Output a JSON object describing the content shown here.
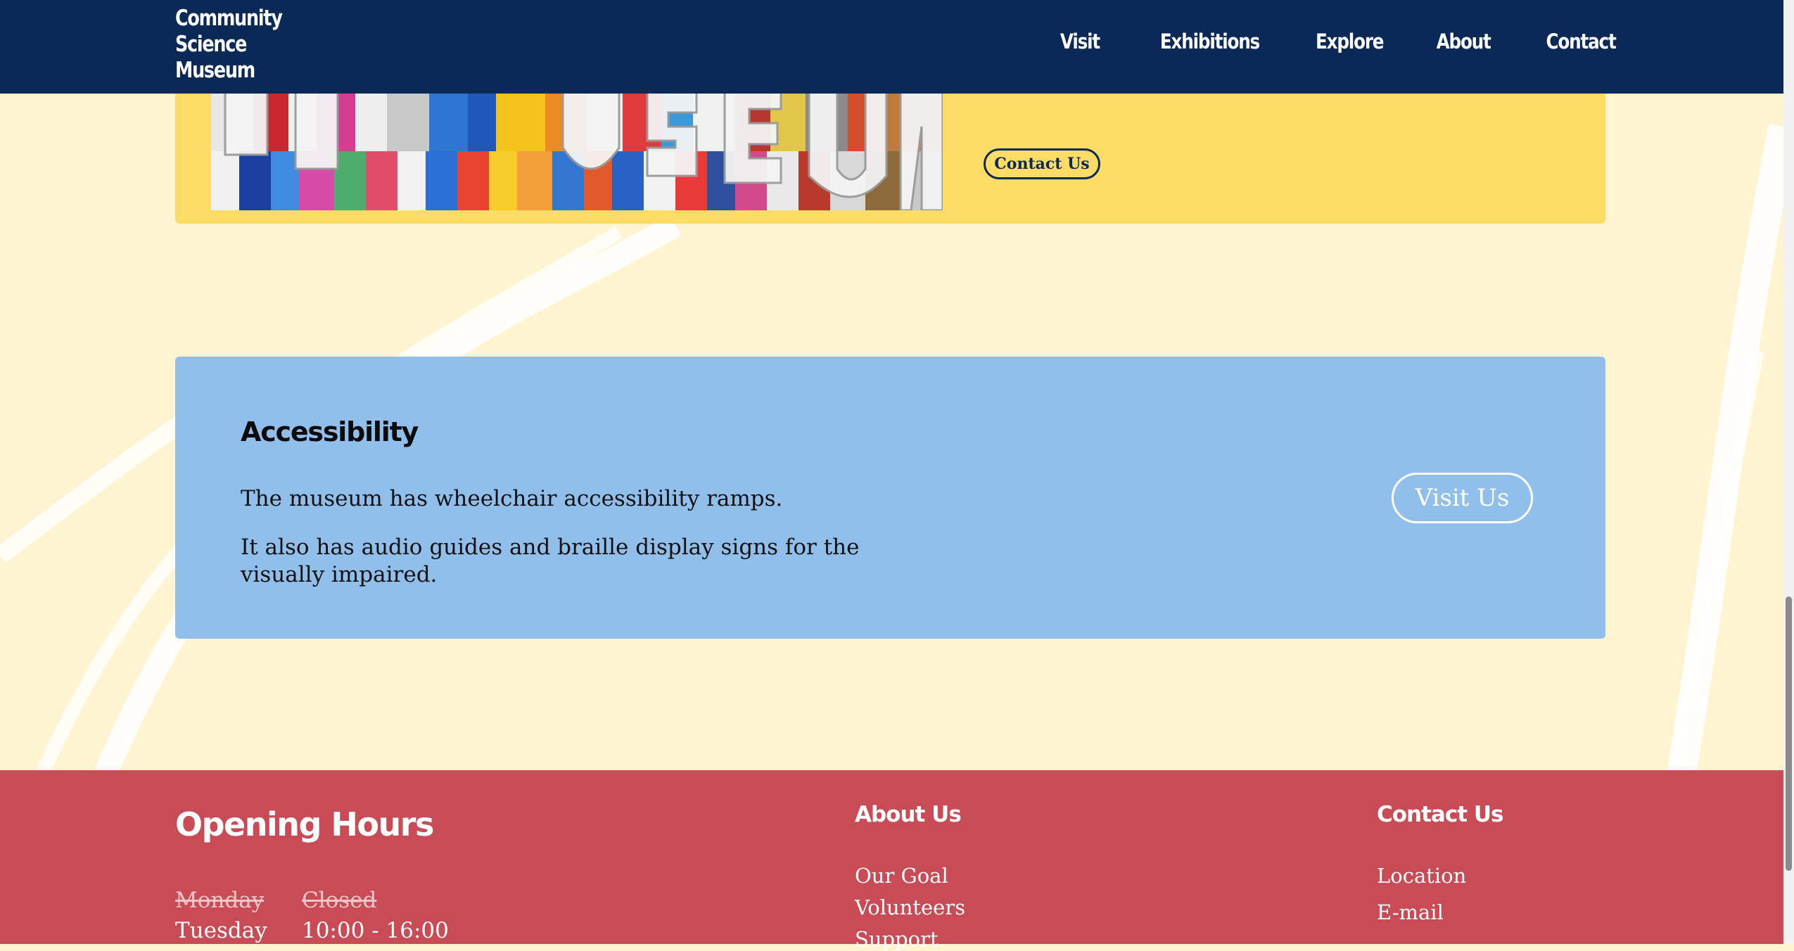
{
  "header": {
    "logo_lines": [
      "Community",
      "Science",
      "Museum"
    ],
    "nav": [
      "Visit",
      "Exhibitions",
      "Explore",
      "About",
      "Contact"
    ]
  },
  "hero": {
    "contact_button": "Contact Us",
    "image": "museum-sign-mosaic"
  },
  "accessibility": {
    "title": "Accessibility",
    "paragraphs": [
      "The museum has wheelchair accessibility ramps.",
      "It also has audio guides and braille display signs for the visually impaired."
    ],
    "visit_button": "Visit Us"
  },
  "footer": {
    "hours_title": "Opening Hours",
    "hours": [
      {
        "day": "Monday",
        "time": "Closed",
        "closed": true
      },
      {
        "day": "Tuesday",
        "time": "10:00 - 16:00",
        "closed": false
      }
    ],
    "about_title": "About Us",
    "about_links": [
      "Our Goal",
      "Volunteers",
      "Support"
    ],
    "contact_title": "Contact Us",
    "contact_links": [
      "Location",
      "E-mail"
    ]
  },
  "colors": {
    "header_bg": "#0a2957",
    "page_bg": "#fff4cf",
    "yellow_card": "#fcdc64",
    "blue_card": "#91bfec",
    "footer_bg": "#c84b55"
  }
}
